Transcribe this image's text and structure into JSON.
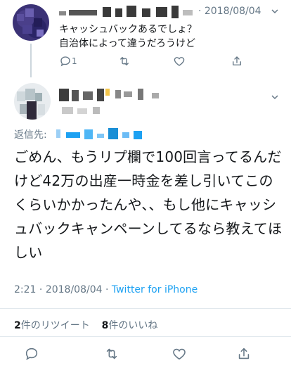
{
  "parent_tweet": {
    "date": "· 2018/08/04",
    "text_line1": "キャッシュバックあるでしょ？",
    "text_line2": "自治体によって違うだろうけど",
    "reply_count": "1"
  },
  "main_tweet": {
    "reply_to_label": "返信先:",
    "text": "ごめん、もうリプ欄で100回言ってるんだけど42万の出産一時金を差し引いてこのくらいかかったんや、、もし他にキャッシュバックキャンペーンしてるなら教えてほしい",
    "time": "2:21",
    "date": "2018/08/04",
    "separator": "·",
    "source": "Twitter for iPhone",
    "retweet_count": "2",
    "retweet_label": "件のリツイート",
    "like_count": "8",
    "like_label": "件のいいね"
  },
  "icons": {
    "reply": "reply-icon",
    "retweet": "retweet-icon",
    "like": "heart-icon",
    "share": "share-icon",
    "more": "chevron-down-icon"
  },
  "colors": {
    "secondary_text": "#657786",
    "link": "#1da1f2",
    "divider": "#e1e8ed",
    "thread_line": "#ccd6dd"
  }
}
